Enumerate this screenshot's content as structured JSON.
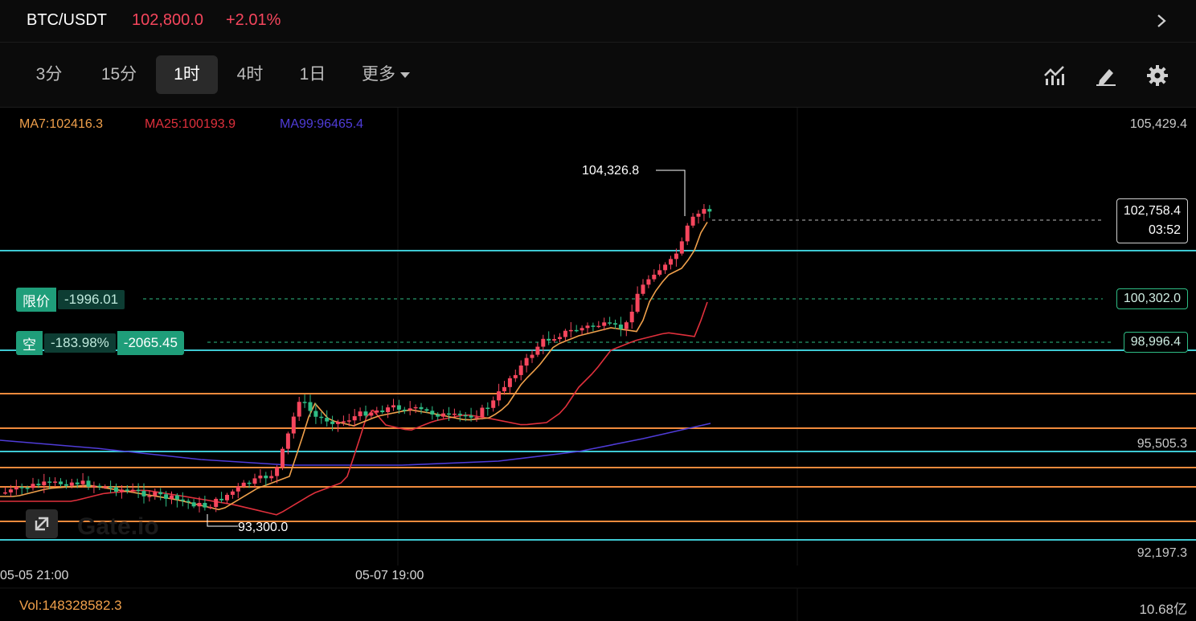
{
  "header": {
    "pair": "BTC/USDT",
    "price": "102,800.0",
    "change": "+2.01%",
    "nav_icon": "chevron-right-icon"
  },
  "intervals": {
    "items": [
      {
        "label": "3分",
        "active": false
      },
      {
        "label": "15分",
        "active": false
      },
      {
        "label": "1时",
        "active": true
      },
      {
        "label": "4时",
        "active": false
      },
      {
        "label": "1日",
        "active": false
      }
    ],
    "more_label": "更多",
    "tools": [
      "indicator-icon",
      "draw-pen-icon",
      "settings-gear-icon"
    ]
  },
  "chart": {
    "ma": {
      "ma7": "MA7:102416.3",
      "ma25": "MA25:100193.9",
      "ma99": "MA99:96465.4"
    },
    "ma_colors": {
      "ma7": "#f0a04b",
      "ma25": "#e0303c",
      "ma99": "#4f3cd8"
    },
    "up_color": "#f6465d",
    "down_color": "#2ebd85",
    "price_axis": {
      "top": "105,429.4",
      "mid": "95,505.3",
      "bottom": "92,197.3"
    },
    "current_price": {
      "value": "102,758.4",
      "countdown": "03:52"
    },
    "limit_line_price": "100,302.0",
    "short_line_price": "98,996.4",
    "high_label": "104,326.8",
    "low_label": "93,300.0",
    "limit_order": {
      "side": "限价",
      "value": "-1996.01"
    },
    "short_position": {
      "side": "空",
      "pct": "-183.98%",
      "pnl": "-2065.45"
    },
    "time_axis": [
      "05-05 21:00",
      "05-07 19:00"
    ],
    "watermark": "Gate.io"
  },
  "volume": {
    "label": "Vol:148328582.3",
    "axis": "10.68亿"
  },
  "chart_data": {
    "type": "candlestick",
    "x": [
      "05-05 21:00",
      "05-07 19:00"
    ],
    "series": [
      {
        "name": "MA7",
        "last": 102416.3
      },
      {
        "name": "MA25",
        "last": 100193.9
      },
      {
        "name": "MA99",
        "last": 96465.4
      }
    ],
    "ylim": [
      92197.3,
      105429.4
    ],
    "high": 104326.8,
    "low": 93300.0,
    "last": 102758.4
  }
}
